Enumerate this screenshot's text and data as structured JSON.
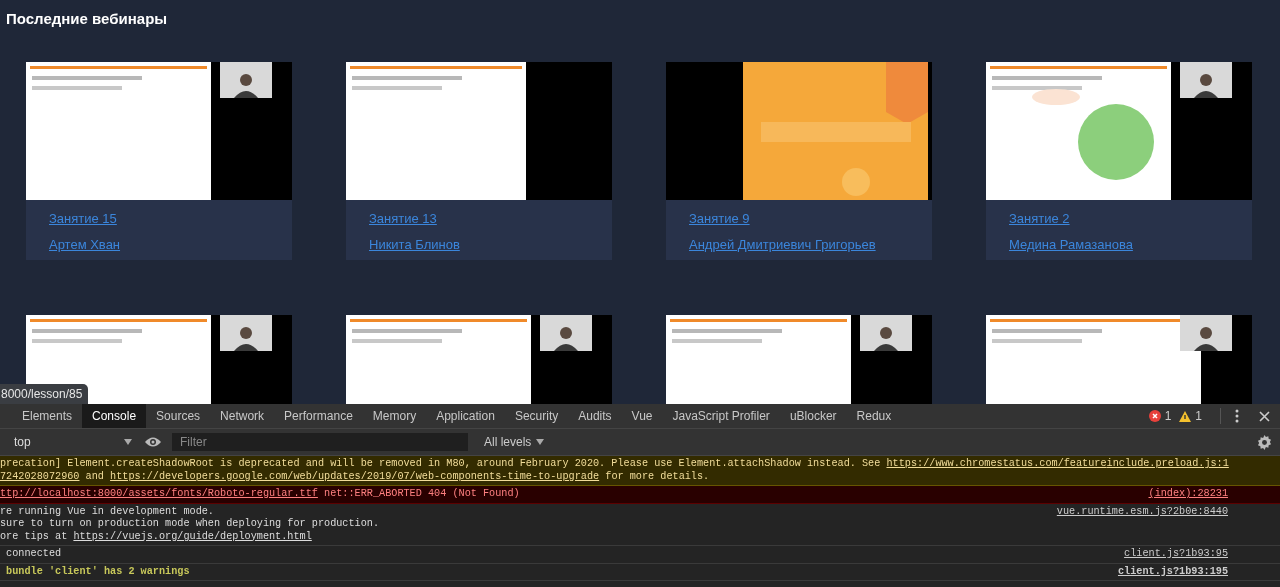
{
  "page": {
    "title": "Последние вебинары",
    "webinars": [
      {
        "kind": "card",
        "lesson": "Занятие 15",
        "teacher": "Артем Хван"
      },
      {
        "kind": "card",
        "lesson": "Занятие 13",
        "teacher": "Никита Блинов"
      },
      {
        "kind": "card",
        "lesson": "Занятие 9",
        "teacher": "Андрей Дмитриевич Григорьев"
      },
      {
        "kind": "card",
        "lesson": "Занятие 2",
        "teacher": "Медина Рамазанова"
      },
      {
        "kind": "thumbnail"
      },
      {
        "kind": "thumbnail"
      },
      {
        "kind": "thumbnail"
      },
      {
        "kind": "thumbnail"
      }
    ],
    "status_url": "8000/lesson/85"
  },
  "devtools": {
    "tabs": [
      {
        "label": "Elements",
        "selected": false
      },
      {
        "label": "Console",
        "selected": true
      },
      {
        "label": "Sources",
        "selected": false
      },
      {
        "label": "Network",
        "selected": false
      },
      {
        "label": "Performance",
        "selected": false
      },
      {
        "label": "Memory",
        "selected": false
      },
      {
        "label": "Application",
        "selected": false
      },
      {
        "label": "Security",
        "selected": false
      },
      {
        "label": "Audits",
        "selected": false
      },
      {
        "label": "Vue",
        "selected": false
      },
      {
        "label": "JavaScript Profiler",
        "selected": false
      },
      {
        "label": "uBlocker",
        "selected": false
      },
      {
        "label": "Redux",
        "selected": false
      }
    ],
    "error_count": "1",
    "warning_count": "1",
    "context": "top",
    "filter_placeholder": "Filter",
    "levels": "All levels",
    "messages": [
      {
        "kind": "warning",
        "source": "include.preload.js:1",
        "lines": [
          [
            {
              "text": "precation] Element.createShadowRoot is deprecated and will be removed in M80, around February 2020. Please use Element.attachShadow instead. See "
            },
            {
              "text": "https://www.chromestatus.com/feature",
              "link": true
            }
          ],
          [
            {
              "text": "7242028072960",
              "link": true
            },
            {
              "text": " and "
            },
            {
              "text": "https://developers.google.com/web/updates/2019/07/web-components-time-to-upgrade",
              "link": true
            },
            {
              "text": " for more details."
            }
          ]
        ]
      },
      {
        "kind": "error",
        "source": "(index):28231",
        "lines": [
          [
            {
              "text": "ttp://localhost:8000/assets/fonts/Roboto-regular.ttf",
              "link": true
            },
            {
              "text": " net::ERR_ABORTED 404 (Not Found)"
            }
          ]
        ]
      },
      {
        "kind": "info",
        "source": "vue.runtime.esm.js?2b0e:8440",
        "lines": [
          [
            {
              "text": "re running Vue in development mode."
            }
          ],
          [
            {
              "text": "sure to turn on production mode when deploying for production."
            }
          ],
          [
            {
              "text": "ore tips at "
            },
            {
              "text": "https://vuejs.org/guide/deployment.html",
              "link": true
            }
          ]
        ]
      },
      {
        "kind": "info",
        "source": "client.js?1b93:95",
        "lines": [
          [
            {
              "text": " connected"
            }
          ]
        ]
      },
      {
        "kind": "verbose",
        "source": "client.js?1b93:195",
        "lines": [
          [
            {
              "text": " bundle 'client' has 2 warnings"
            }
          ]
        ]
      }
    ]
  }
}
